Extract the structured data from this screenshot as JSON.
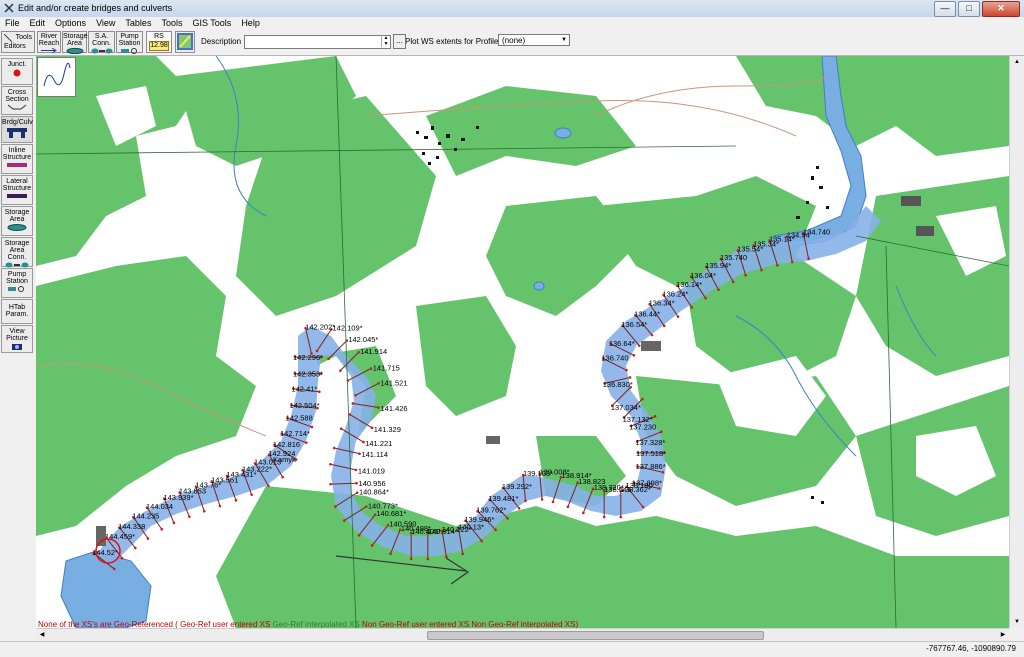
{
  "window": {
    "title": "Edit and/or create bridges and culverts",
    "buttons": {
      "minimize": "—",
      "maximize": "□",
      "close": "✕"
    }
  },
  "menu": [
    "File",
    "Edit",
    "Options",
    "View",
    "Tables",
    "Tools",
    "GIS Tools",
    "Help"
  ],
  "toolbar": {
    "tools_label": "Tools",
    "editors_label": "Editors",
    "river_reach_line1": "River",
    "river_reach_line2": "Reach",
    "storage_area_line1": "Storage",
    "storage_area_line2": "Area",
    "sa_conn_line1": "S.A.",
    "sa_conn_line2": "Conn.",
    "pump_station_line1": "Pump",
    "pump_station_line2": "Station",
    "rs_label": "RS",
    "rs_value": "12.98",
    "description_label": "Description :",
    "description_value": "",
    "dots_label": "...",
    "plot_ws_label": "Plot WS extents for Profile:",
    "profile_value": "(none)"
  },
  "sidebar": [
    {
      "line1": "Junct.",
      "line2": ""
    },
    {
      "line1": "Cross",
      "line2": "Section"
    },
    {
      "line1": "Brdg/Culv",
      "line2": ""
    },
    {
      "line1": "Inline",
      "line2": "Structure"
    },
    {
      "line1": "Lateral",
      "line2": "Structure"
    },
    {
      "line1": "Storage",
      "line2": "Area"
    },
    {
      "line1": "Storage",
      "line2": "Area Conn."
    },
    {
      "line1": "Pump",
      "line2": "Station"
    },
    {
      "line1": "HTab",
      "line2": "Param."
    },
    {
      "line1": "View",
      "line2": "Picture"
    }
  ],
  "map": {
    "place_label": "Kamyk",
    "cross_sections": [
      "134.740",
      "134.94",
      "135.14*",
      "135.34*",
      "135.54*",
      "135.740",
      "135.94*",
      "136.04*",
      "136.14*",
      "136.24*",
      "136.34*",
      "136.44*",
      "136.54*",
      "136.64*",
      "136.740",
      "136.830*",
      "137.034*",
      "137.132*",
      "137.230",
      "137.328*",
      "137.518*",
      "137.886*",
      "137.898*",
      "138.180",
      "138.362*",
      "138.545",
      "138.720*",
      "138.823",
      "138.914*",
      "139.008*",
      "139.103*",
      "139.292*",
      "139.481*",
      "139.762*",
      "139.946*",
      "140.13*",
      "140.222*",
      "140.314*",
      "140.406*",
      "140.498*",
      "140.590",
      "140.681*",
      "140.773*",
      "140.864*",
      "140.956",
      "141.019",
      "141.114",
      "141.221",
      "141.329",
      "141.426",
      "141.521",
      "141.715",
      "141.914",
      "142.045*",
      "142.109*",
      "142.202*",
      "142.296*",
      "142.353*",
      "142.41*",
      "142.504*",
      "142.588",
      "142.714*",
      "142.816",
      "142.924",
      "143.013",
      "143.222*",
      "143.431*",
      "143.561",
      "143.76*",
      "143.853",
      "143.939*",
      "144.034",
      "144.235",
      "144.338",
      "144.459*",
      "144.52*"
    ]
  },
  "legend": [
    {
      "text": "None of the XS's are Geo-Referenced",
      "color": "#c00000"
    },
    {
      "text": "( ",
      "color": "#c00000"
    },
    {
      "text": "Geo-Ref user entered XS",
      "color": "#c00000"
    },
    {
      "text": "Geo-Ref interpolated XS",
      "color": "#2f7f2f"
    },
    {
      "text": "Non Geo-Ref user entered XS",
      "color": "#c00000"
    },
    {
      "text": "Non Geo-Ref interpolated XS)",
      "color": "#c00000"
    }
  ],
  "status": {
    "coordinates": "-767767.46, -1090890.79"
  },
  "colors": {
    "forest": "#64c36b",
    "water": "#78aee2",
    "river_polygon": "#86b1e8",
    "xs_line": "#7a2222",
    "xs_dot": "#d11a1a"
  }
}
